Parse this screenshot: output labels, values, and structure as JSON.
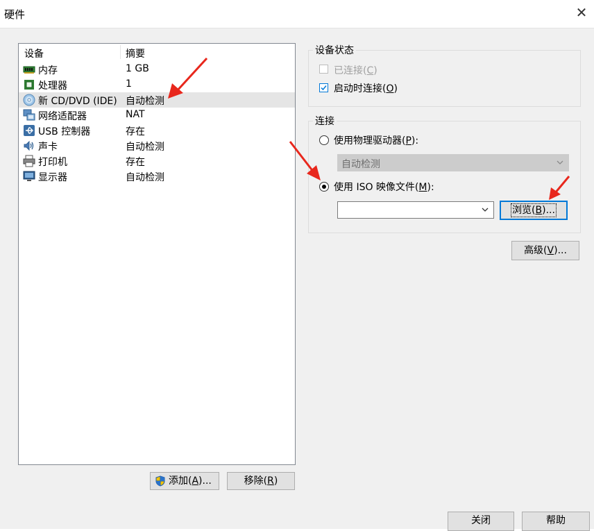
{
  "window": {
    "title": "硬件"
  },
  "device_list": {
    "columns": [
      "设备",
      "摘要"
    ],
    "rows": [
      {
        "icon": "memory-icon",
        "name": "内存",
        "summary": "1 GB"
      },
      {
        "icon": "processor-icon",
        "name": "处理器",
        "summary": "1"
      },
      {
        "icon": "cd-dvd-icon",
        "name": "新 CD/DVD (IDE)",
        "summary": "自动检测",
        "selected": true
      },
      {
        "icon": "network-adapter-icon",
        "name": "网络适配器",
        "summary": "NAT"
      },
      {
        "icon": "usb-icon",
        "name": "USB 控制器",
        "summary": "存在"
      },
      {
        "icon": "sound-card-icon",
        "name": "声卡",
        "summary": "自动检测"
      },
      {
        "icon": "printer-icon",
        "name": "打印机",
        "summary": "存在"
      },
      {
        "icon": "display-icon",
        "name": "显示器",
        "summary": "自动检测"
      }
    ]
  },
  "buttons": {
    "add": {
      "text": "添加(",
      "key": "A",
      "suffix": ")..."
    },
    "remove": {
      "text": "移除(",
      "key": "R",
      "suffix": ")"
    },
    "browse": {
      "text": "浏览(",
      "key": "B",
      "suffix": ")..."
    },
    "advanced": {
      "text": "高级(",
      "key": "V",
      "suffix": ")..."
    },
    "close": "关闭",
    "help": "帮助"
  },
  "device_status": {
    "label": "设备状态",
    "connected": {
      "text": "已连接(",
      "key": "C",
      "suffix": ")",
      "checked": false,
      "disabled": true
    },
    "connect_at_power_on": {
      "text": "启动时连接(",
      "key": "O",
      "suffix": ")",
      "checked": true
    }
  },
  "connection": {
    "label": "连接",
    "physical_drive": {
      "text": "使用物理驱动器(",
      "key": "P",
      "suffix": "):",
      "selected": false,
      "combo_value": "自动检测"
    },
    "iso_image": {
      "text": "使用 ISO 映像文件(",
      "key": "M",
      "suffix": "):",
      "selected": true,
      "path_value": ""
    }
  },
  "colors": {
    "annotation_arrow": "#e8271c",
    "focus_blue": "#0078d7",
    "selection": "#e5e5e5"
  }
}
